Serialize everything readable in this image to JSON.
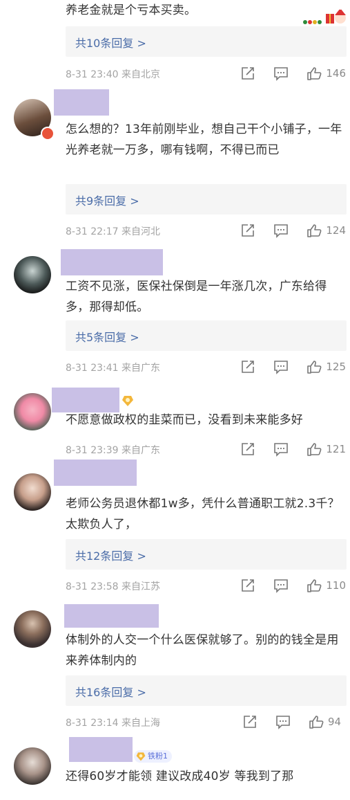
{
  "top": {
    "text": "养老金就是个亏本买卖。",
    "replies": "共10条回复 >",
    "meta": "8-31 23:40  来自北京",
    "likes": "146"
  },
  "comments": [
    {
      "text": "怎么想的？13年前刚毕业，想自己干个小铺子，一年光养老就一万多，哪有钱啊，不得已而已",
      "replies": "共9条回复 >",
      "meta": "8-31 22:17  来自河北",
      "likes": "124"
    },
    {
      "text": "工资不见涨，医保社保倒是一年涨几次，广东给得多，那得却低。",
      "replies": "共5条回复 >",
      "meta": "8-31 23:41  来自广东",
      "likes": "125"
    },
    {
      "text": "不愿意做政权的韭菜而已，没看到未来能多好",
      "meta": "8-31 23:39  来自广东",
      "likes": "121"
    },
    {
      "text": "老师公务员退休都1w多，凭什么普通职工就2.3千？太欺负人了，",
      "replies": "共12条回复 >",
      "meta": "8-31 23:58  来自江苏",
      "likes": "110"
    },
    {
      "text": "体制外的人交一个什么医保就够了。别的的钱全是用来养体制内的",
      "replies": "共16条回复 >",
      "meta": "8-31 23:14  来自上海",
      "likes": "94"
    },
    {
      "text": "还得60岁才能领 建议改成40岁 等我到了那",
      "badge": "铁粉1"
    }
  ],
  "icons": {
    "share": "share-icon",
    "comment": "comment-icon",
    "like": "thumbs-up-icon"
  },
  "colors": {
    "link": "#4a6ca8",
    "meta": "#a3a3a3",
    "name_mask": "#c9c0e6",
    "reply_bg": "#f5f5f5"
  }
}
